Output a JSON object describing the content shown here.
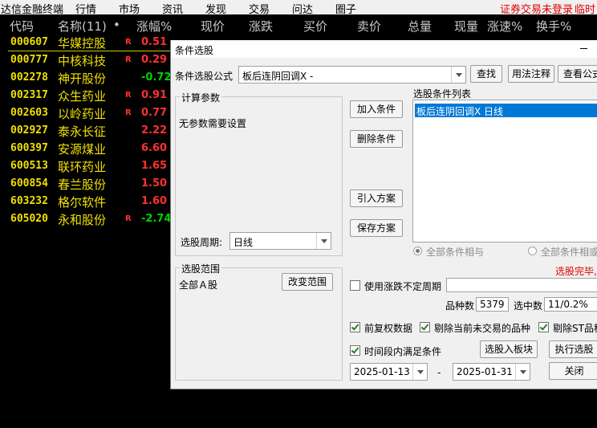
{
  "menubar": {
    "app_title": "达信金融终端",
    "items": [
      "行情",
      "市场",
      "资讯",
      "发现",
      "交易",
      "问达",
      "圈子"
    ],
    "status": "证券交易未登录",
    "status2": "临时"
  },
  "table": {
    "headers": [
      "代码",
      "名称(11)",
      "•",
      "涨幅%",
      "现价",
      "涨跌",
      "买价",
      "卖价",
      "总量",
      "现量",
      "涨速%",
      "换手%"
    ],
    "rows": [
      {
        "code": "000607",
        "name": "华媒控股",
        "flag": "R",
        "chg": "0.51",
        "dir": "up"
      },
      {
        "code": "000777",
        "name": "中核科技",
        "flag": "R",
        "chg": "0.29",
        "dir": "up"
      },
      {
        "code": "002278",
        "name": "神开股份",
        "flag": "",
        "chg": "-0.72",
        "dir": "dn"
      },
      {
        "code": "002317",
        "name": "众生药业",
        "flag": "R",
        "chg": "0.91",
        "dir": "up"
      },
      {
        "code": "002603",
        "name": "以岭药业",
        "flag": "R",
        "chg": "0.77",
        "dir": "up"
      },
      {
        "code": "002927",
        "name": "泰永长征",
        "flag": "",
        "chg": "2.22",
        "dir": "up"
      },
      {
        "code": "600397",
        "name": "安源煤业",
        "flag": "",
        "chg": "6.60",
        "dir": "up"
      },
      {
        "code": "600513",
        "name": "联环药业",
        "flag": "",
        "chg": "1.65",
        "dir": "up"
      },
      {
        "code": "600854",
        "name": "春兰股份",
        "flag": "",
        "chg": "1.50",
        "dir": "up"
      },
      {
        "code": "603232",
        "name": "格尔软件",
        "flag": "",
        "chg": "1.60",
        "dir": "up"
      },
      {
        "code": "605020",
        "name": "永和股份",
        "flag": "R",
        "chg": "-2.74",
        "dir": "dn"
      }
    ]
  },
  "dialog": {
    "title": "条件选股",
    "formula_label": "条件选股公式",
    "formula_value": "板后连阴回调X -",
    "find_btn": "查找",
    "usage_btn": "用法注释",
    "view_btn": "查看公式",
    "params_group": "计算参数",
    "params_text": "无参数需要设置",
    "add_btn": "加入条件",
    "del_btn": "删除条件",
    "import_btn": "引入方案",
    "save_btn": "保存方案",
    "list_label": "选股条件列表",
    "list_items": [
      "板后连阴回调X  日线"
    ],
    "radio_and": "全部条件相与",
    "radio_or": "全部条件相或",
    "done_text": "选股完毕,",
    "period_label": "选股周期:",
    "period_value": "日线",
    "range_group": "选股范围",
    "range_value": "全部Ａ股",
    "change_range_btn": "改变范围",
    "use_uncertain": "使用涨跌不定周期",
    "count_label": "品种数",
    "count_value": "5379",
    "selected_label": "选中数",
    "selected_value": "11/0.2%",
    "fq_label": "前复权数据",
    "exclude_untraded": "剔除当前未交易的品种",
    "exclude_st": "剔除ST品种",
    "time_range": "时间段内满足条件",
    "to_block_btn": "选股入板块",
    "exec_btn": "执行选股",
    "close_btn": "关闭",
    "date_from": "2025-01-13",
    "date_sep": "-",
    "date_to": "2025-01-31"
  }
}
